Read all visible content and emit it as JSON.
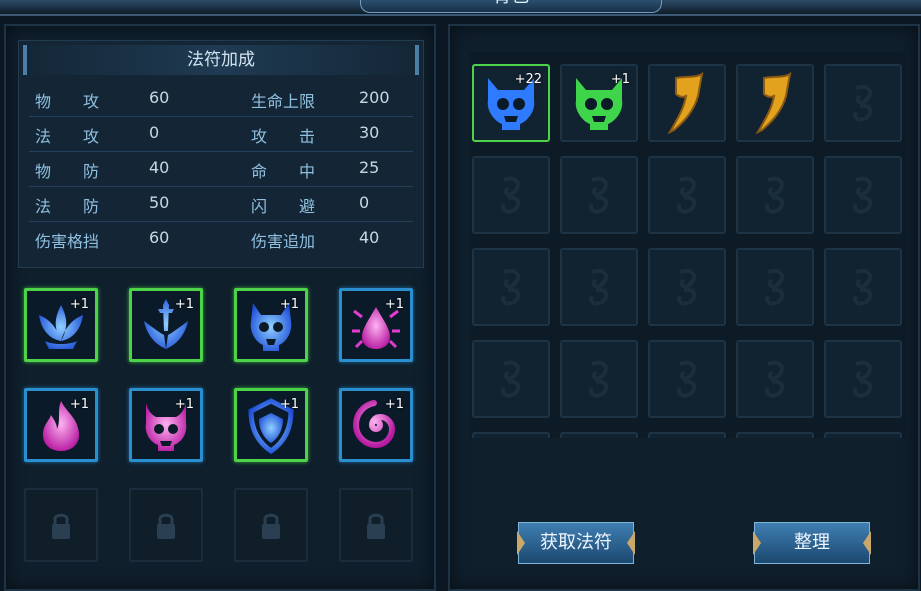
{
  "window": {
    "title": "背包"
  },
  "stats": {
    "header": "法符加成",
    "rows": [
      {
        "l1": "物　　攻",
        "v1": "60",
        "l2": "生命上限",
        "v2": "200"
      },
      {
        "l1": "法　　攻",
        "v1": "0",
        "l2": "攻　　击",
        "v2": "30"
      },
      {
        "l1": "物　　防",
        "v1": "40",
        "l2": "命　　中",
        "v2": "25"
      },
      {
        "l1": "法　　防",
        "v1": "50",
        "l2": "闪　　避",
        "v2": "0"
      },
      {
        "l1": "伤害格挡",
        "v1": "60",
        "l2": "伤害追加",
        "v2": "40"
      }
    ]
  },
  "equipped_runes": [
    {
      "icon": "lotus-rune-icon",
      "level": "+1",
      "frame": "green",
      "color": "#2f7bff"
    },
    {
      "icon": "sword-rune-icon",
      "level": "+1",
      "frame": "green",
      "color": "#2f7bff"
    },
    {
      "icon": "demon-skull-rune-icon",
      "level": "+1",
      "frame": "green",
      "color": "#2f7bff"
    },
    {
      "icon": "blood-drop-rune-icon",
      "level": "+1",
      "frame": "blue",
      "color": "#e23bd0"
    },
    {
      "icon": "flame-rune-icon",
      "level": "+1",
      "frame": "blue",
      "color": "#e23bd0"
    },
    {
      "icon": "horned-skull-rune-icon",
      "level": "+1",
      "frame": "blue",
      "color": "#e23bd0"
    },
    {
      "icon": "shield-rune-icon",
      "level": "+1",
      "frame": "green",
      "color": "#2f7bff"
    },
    {
      "icon": "vortex-rune-icon",
      "level": "+1",
      "frame": "blue",
      "color": "#e23bd0"
    }
  ],
  "locked_slots": [
    {
      "icon": "padlock-icon"
    },
    {
      "icon": "padlock-icon"
    },
    {
      "icon": "padlock-icon"
    },
    {
      "icon": "padlock-icon"
    }
  ],
  "bag_items": [
    {
      "icon": "blue-demon-skull-item-icon",
      "count": "+22",
      "color": "#2f7bff",
      "selected": true
    },
    {
      "icon": "green-demon-skull-item-icon",
      "count": "+1",
      "color": "#3fd54a",
      "selected": false
    },
    {
      "icon": "gold-talisman-scroll-icon",
      "count": "",
      "color": "#e2a21d",
      "selected": false
    },
    {
      "icon": "gold-talisman-scroll-icon",
      "count": "",
      "color": "#e2a21d",
      "selected": false
    }
  ],
  "buttons": {
    "acquire": "获取法符",
    "sort": "整理"
  },
  "colors": {
    "selected_frame": "#4cd34a",
    "blue_frame": "#2a8fcf",
    "panel_bg": "#0f1f2c"
  }
}
